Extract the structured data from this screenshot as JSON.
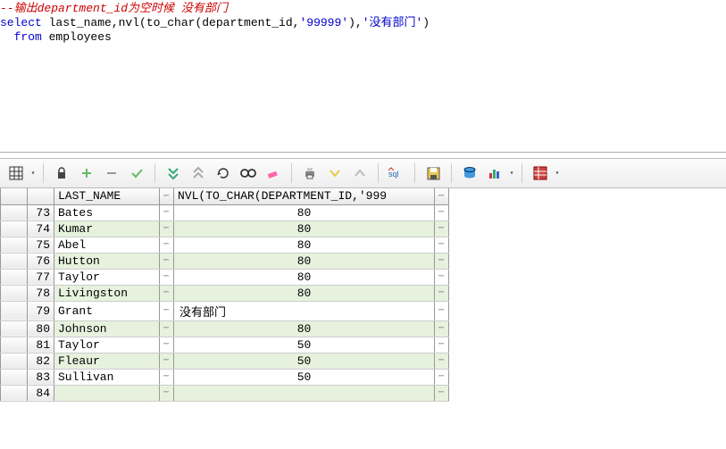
{
  "sql": {
    "comment": "--输出department_id为空时候 没有部门",
    "line2_select": "select",
    "line2_rest_a": " last_name,nvl(to_char(department_id,",
    "line2_str": "'99999'",
    "line2_rest_b": "),",
    "line2_str2": "'没有部门'",
    "line2_rest_c": ")",
    "line3_from": "  from",
    "line3_rest": " employees"
  },
  "columns": {
    "c1": "LAST_NAME",
    "c2": "NVL(TO_CHAR(DEPARTMENT_ID,'999"
  },
  "rows": [
    {
      "n": "73",
      "name": "Bates",
      "dept": "80"
    },
    {
      "n": "74",
      "name": "Kumar",
      "dept": "80"
    },
    {
      "n": "75",
      "name": "Abel",
      "dept": "80"
    },
    {
      "n": "76",
      "name": "Hutton",
      "dept": "80"
    },
    {
      "n": "77",
      "name": "Taylor",
      "dept": "80"
    },
    {
      "n": "78",
      "name": "Livingston",
      "dept": "80"
    },
    {
      "n": "79",
      "name": "Grant",
      "dept": "没有部门"
    },
    {
      "n": "80",
      "name": "Johnson",
      "dept": "80"
    },
    {
      "n": "81",
      "name": "Taylor",
      "dept": "50"
    },
    {
      "n": "82",
      "name": "Fleaur",
      "dept": "50"
    },
    {
      "n": "83",
      "name": "Sullivan",
      "dept": "50"
    },
    {
      "n": "84",
      "name": "",
      "dept": ""
    }
  ],
  "icons": {
    "grid": "grid",
    "lock": "lock",
    "plus": "plus",
    "minus": "minus",
    "check": "check",
    "down2": "dbl-down",
    "up2": "dbl-up",
    "redo": "redo",
    "binoc": "binoc",
    "eraser": "eraser",
    "printer": "printer",
    "vdown": "vdown",
    "vup": "vup",
    "sql": "sql",
    "save": "save",
    "db": "db",
    "chart": "chart",
    "table": "table"
  }
}
